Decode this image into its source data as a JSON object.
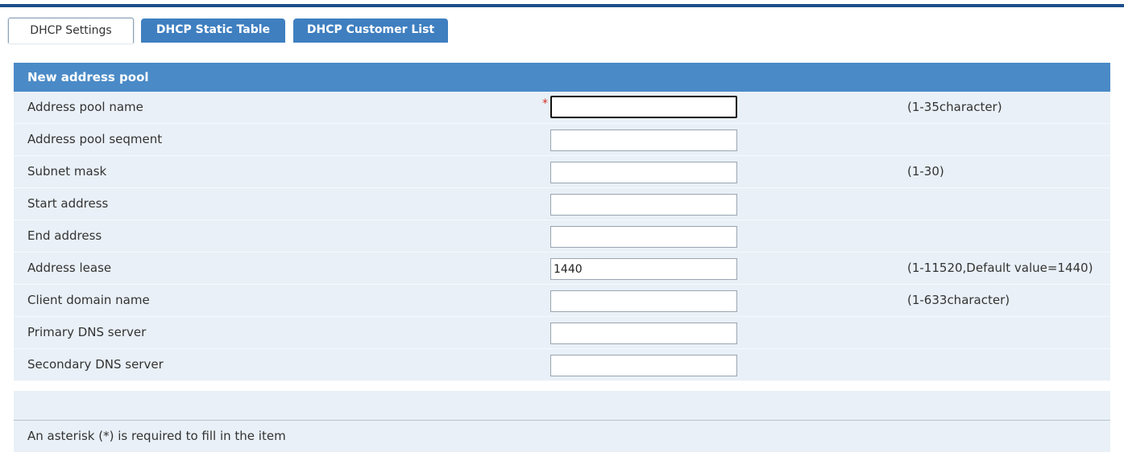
{
  "tabs": [
    {
      "label": "DHCP Settings"
    },
    {
      "label": "DHCP Static Table"
    },
    {
      "label": "DHCP Customer List"
    }
  ],
  "form": {
    "header": "New address pool",
    "required_mark": "*",
    "fields": [
      {
        "label": "Address pool name",
        "value": "",
        "hint": "(1-35character)"
      },
      {
        "label": "Address pool seqment",
        "value": "",
        "hint": ""
      },
      {
        "label": "Subnet mask",
        "value": "",
        "hint": "(1-30)"
      },
      {
        "label": "Start address",
        "value": "",
        "hint": ""
      },
      {
        "label": "End address",
        "value": "",
        "hint": ""
      },
      {
        "label": "Address lease",
        "value": "1440",
        "hint": "(1-11520,Default value=1440)"
      },
      {
        "label": "Client domain name",
        "value": "",
        "hint": "(1-633character)"
      },
      {
        "label": "Primary DNS server",
        "value": "",
        "hint": ""
      },
      {
        "label": "Secondary DNS server",
        "value": "",
        "hint": ""
      }
    ]
  },
  "footer": {
    "note": "An asterisk (*) is required to fill in the item"
  },
  "colors": {
    "header_bg": "#4a8ac7",
    "tab_bg": "#3f7fc0",
    "row_bg": "#e9f0f7",
    "required": "#d9302a"
  }
}
